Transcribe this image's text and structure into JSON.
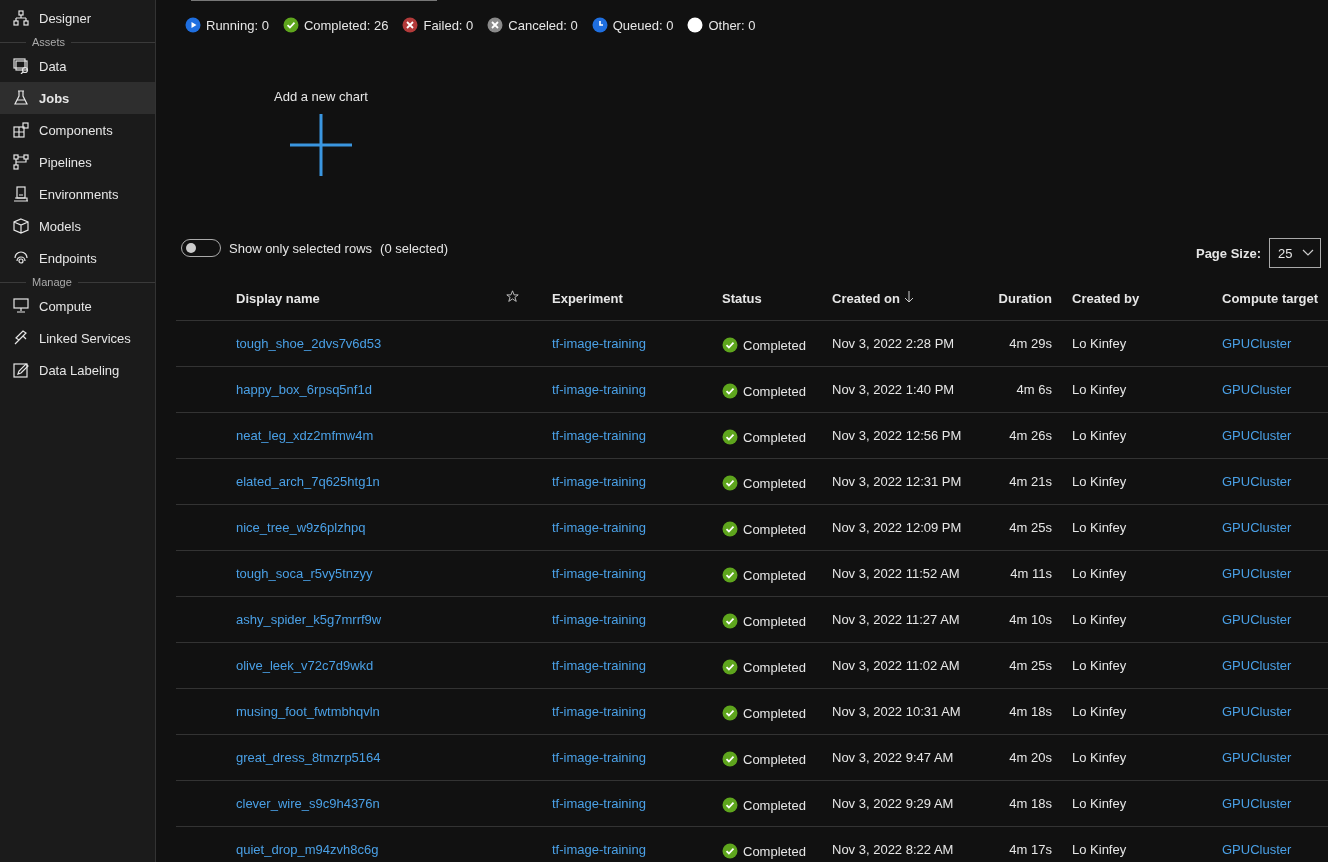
{
  "sidebar": {
    "items": [
      {
        "label": "Designer",
        "selected": false
      }
    ],
    "sections": [
      {
        "title": "Assets",
        "items": [
          {
            "label": "Data",
            "selected": false
          },
          {
            "label": "Jobs",
            "selected": true
          },
          {
            "label": "Components",
            "selected": false
          },
          {
            "label": "Pipelines",
            "selected": false
          },
          {
            "label": "Environments",
            "selected": false
          },
          {
            "label": "Models",
            "selected": false
          },
          {
            "label": "Endpoints",
            "selected": false
          }
        ]
      },
      {
        "title": "Manage",
        "items": [
          {
            "label": "Compute",
            "selected": false
          },
          {
            "label": "Linked Services",
            "selected": false
          },
          {
            "label": "Data Labeling",
            "selected": false
          }
        ]
      }
    ]
  },
  "status_summary": [
    {
      "kind": "running",
      "label": "Running: 0"
    },
    {
      "kind": "completed",
      "label": "Completed: 26"
    },
    {
      "kind": "failed",
      "label": "Failed: 0"
    },
    {
      "kind": "canceled",
      "label": "Canceled: 0"
    },
    {
      "kind": "queued",
      "label": "Queued: 0"
    },
    {
      "kind": "other",
      "label": "Other: 0"
    }
  ],
  "add_chart": {
    "label": "Add a new chart"
  },
  "selected_toggle": {
    "on": false,
    "label": "Show only selected rows",
    "count": "(0 selected)"
  },
  "page_size": {
    "label": "Page Size:",
    "value": "25"
  },
  "table": {
    "columns": [
      "Display name",
      "Experiment",
      "Status",
      "Created on",
      "Duration",
      "Created by",
      "Compute target"
    ],
    "rows": [
      {
        "name": "tough_shoe_2dvs7v6d53",
        "experiment": "tf-image-training",
        "status": "Completed",
        "kind": "completed",
        "created_on": "Nov 3, 2022 2:28 PM",
        "duration": "4m 29s",
        "created_by": "Lo Kinfey",
        "compute": "GPUCluster"
      },
      {
        "name": "happy_box_6rpsq5nf1d",
        "experiment": "tf-image-training",
        "status": "Completed",
        "kind": "completed",
        "created_on": "Nov 3, 2022 1:40 PM",
        "duration": "4m 6s",
        "created_by": "Lo Kinfey",
        "compute": "GPUCluster"
      },
      {
        "name": "neat_leg_xdz2mfmw4m",
        "experiment": "tf-image-training",
        "status": "Completed",
        "kind": "completed",
        "created_on": "Nov 3, 2022 12:56 PM",
        "duration": "4m 26s",
        "created_by": "Lo Kinfey",
        "compute": "GPUCluster"
      },
      {
        "name": "elated_arch_7q625htg1n",
        "experiment": "tf-image-training",
        "status": "Completed",
        "kind": "completed",
        "created_on": "Nov 3, 2022 12:31 PM",
        "duration": "4m 21s",
        "created_by": "Lo Kinfey",
        "compute": "GPUCluster"
      },
      {
        "name": "nice_tree_w9z6plzhpq",
        "experiment": "tf-image-training",
        "status": "Completed",
        "kind": "completed",
        "created_on": "Nov 3, 2022 12:09 PM",
        "duration": "4m 25s",
        "created_by": "Lo Kinfey",
        "compute": "GPUCluster"
      },
      {
        "name": "tough_soca_r5vy5tnzyy",
        "experiment": "tf-image-training",
        "status": "Completed",
        "kind": "completed",
        "created_on": "Nov 3, 2022 11:52 AM",
        "duration": "4m 11s",
        "created_by": "Lo Kinfey",
        "compute": "GPUCluster"
      },
      {
        "name": "ashy_spider_k5g7mrrf9w",
        "experiment": "tf-image-training",
        "status": "Completed",
        "kind": "completed",
        "created_on": "Nov 3, 2022 11:27 AM",
        "duration": "4m 10s",
        "created_by": "Lo Kinfey",
        "compute": "GPUCluster"
      },
      {
        "name": "olive_leek_v72c7d9wkd",
        "experiment": "tf-image-training",
        "status": "Completed",
        "kind": "completed",
        "created_on": "Nov 3, 2022 11:02 AM",
        "duration": "4m 25s",
        "created_by": "Lo Kinfey",
        "compute": "GPUCluster"
      },
      {
        "name": "musing_foot_fwtmbhqvln",
        "experiment": "tf-image-training",
        "status": "Completed",
        "kind": "completed",
        "created_on": "Nov 3, 2022 10:31 AM",
        "duration": "4m 18s",
        "created_by": "Lo Kinfey",
        "compute": "GPUCluster"
      },
      {
        "name": "great_dress_8tmzrp5164",
        "experiment": "tf-image-training",
        "status": "Completed",
        "kind": "completed",
        "created_on": "Nov 3, 2022 9:47 AM",
        "duration": "4m 20s",
        "created_by": "Lo Kinfey",
        "compute": "GPUCluster"
      },
      {
        "name": "clever_wire_s9c9h4376n",
        "experiment": "tf-image-training",
        "status": "Completed",
        "kind": "completed",
        "created_on": "Nov 3, 2022 9:29 AM",
        "duration": "4m 18s",
        "created_by": "Lo Kinfey",
        "compute": "GPUCluster"
      },
      {
        "name": "quiet_drop_m94zvh8c6g",
        "experiment": "tf-image-training",
        "status": "Completed",
        "kind": "completed",
        "created_on": "Nov 3, 2022 8:22 AM",
        "duration": "4m 17s",
        "created_by": "Lo Kinfey",
        "compute": "GPUCluster"
      }
    ]
  }
}
